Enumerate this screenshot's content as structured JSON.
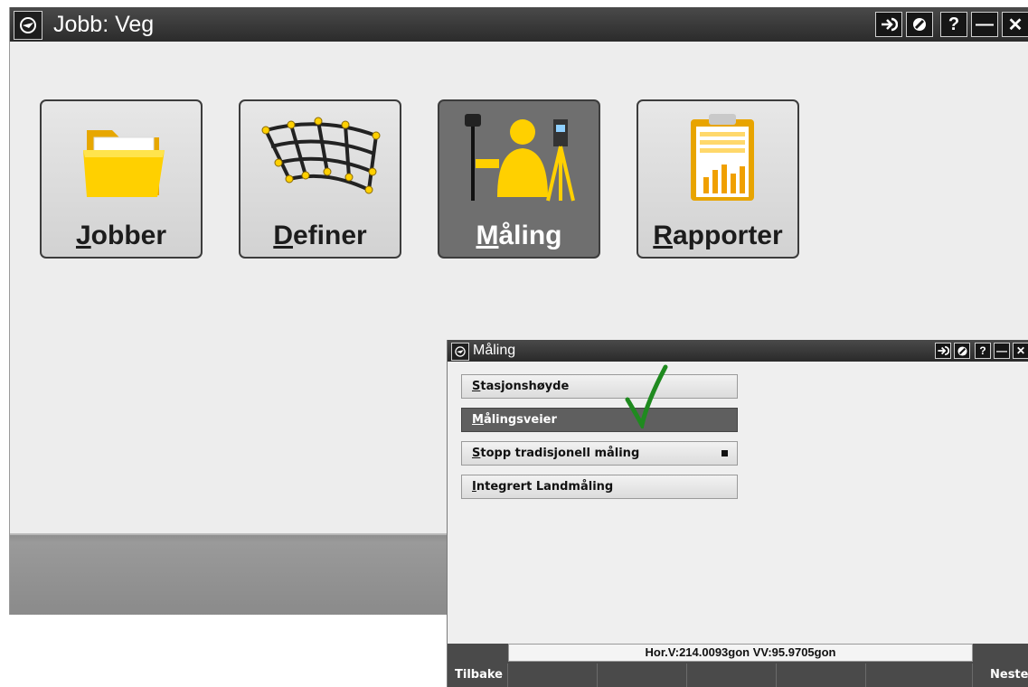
{
  "main": {
    "title": "Jobb: Veg",
    "tiles": [
      {
        "first": "J",
        "rest": "obber"
      },
      {
        "first": "D",
        "rest": "efiner"
      },
      {
        "first": "M",
        "rest": "åling"
      },
      {
        "first": "R",
        "rest": "apporter"
      }
    ],
    "titlebar_buttons": [
      "→",
      "⊘",
      "?",
      "—",
      "✕"
    ]
  },
  "dialog": {
    "title": "Måling",
    "items": [
      {
        "first": "S",
        "rest": "tasjonshøyde"
      },
      {
        "first": "M",
        "rest": "ålingsveier"
      },
      {
        "first": "S",
        "rest": "topp tradisjonell måling"
      },
      {
        "first": "I",
        "rest": "ntegrert Landmåling"
      }
    ],
    "status": "Hor.V:214.0093gon  VV:95.9705gon",
    "back_label": "Tilbake",
    "next_label": "Neste"
  },
  "colors": {
    "titlebar": "#2b2b2b",
    "selected": "#5f5f5f",
    "accent_yellow": "#f5c400",
    "checkmark": "#1f8a1f"
  },
  "icons": [
    "app-logo-icon",
    "folder-icon",
    "grid-mesh-icon",
    "surveyor-icon",
    "report-clipboard-icon",
    "checkmark-icon"
  ]
}
